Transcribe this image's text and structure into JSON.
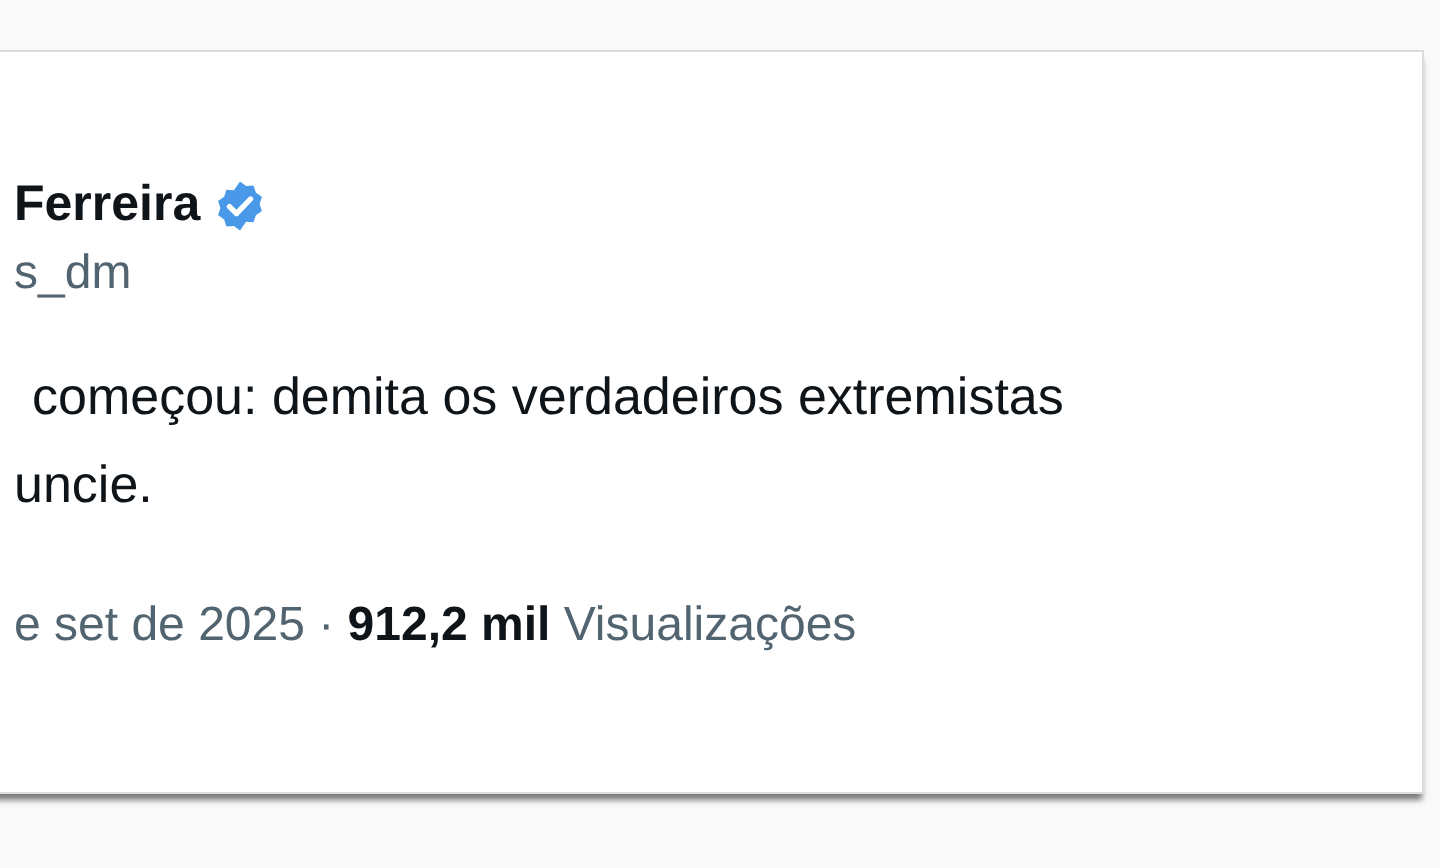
{
  "author": {
    "name": "Ferreira",
    "verified": true,
    "handle": "s_dm"
  },
  "text": [
    "começou: demita os verdadeiros extremistas",
    "uncie."
  ],
  "footer": {
    "date": "e set de 2025 · **912,2 mil** Visualizações"
  }
}
